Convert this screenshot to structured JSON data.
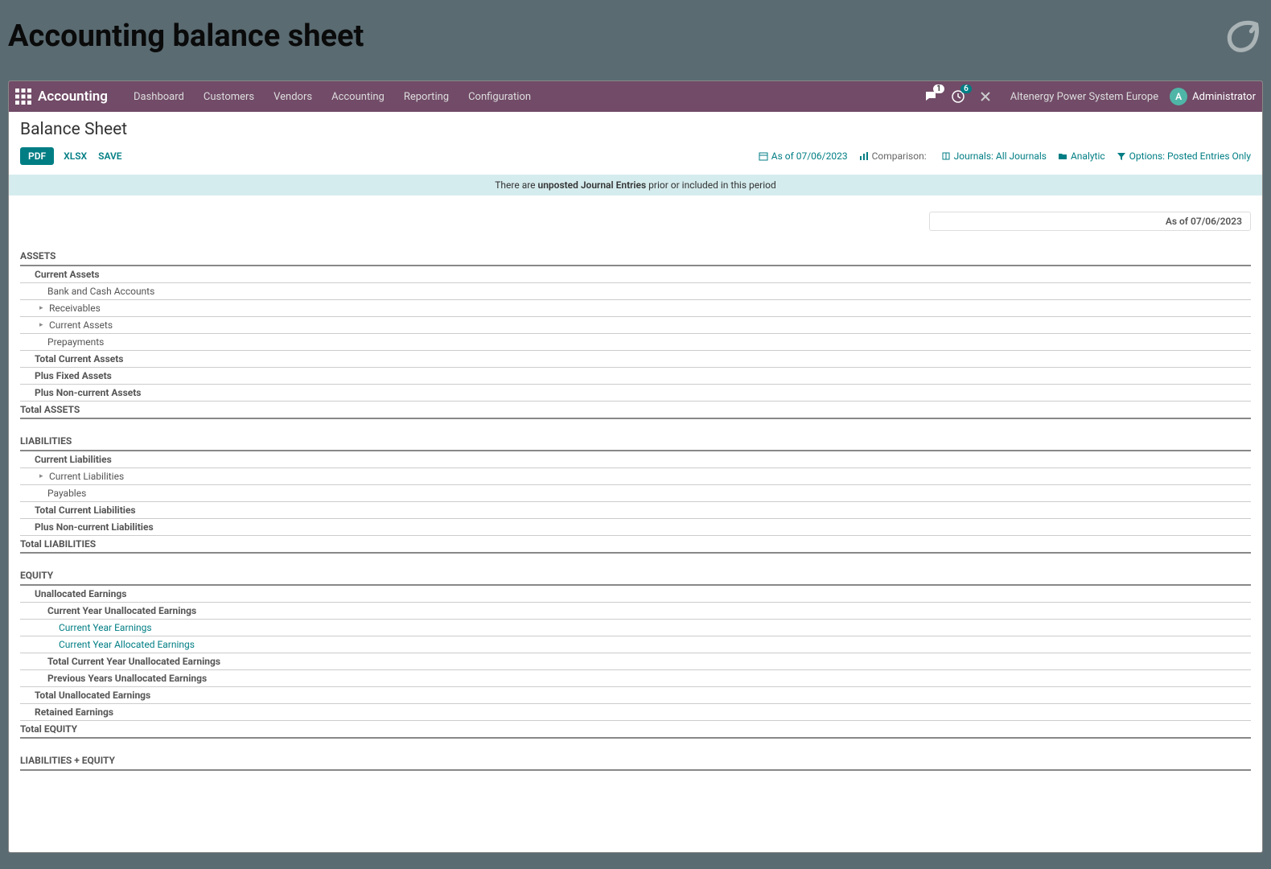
{
  "header": {
    "title": "Accounting balance sheet"
  },
  "nav": {
    "app_name": "Accounting",
    "items": [
      "Dashboard",
      "Customers",
      "Vendors",
      "Accounting",
      "Reporting",
      "Configuration"
    ],
    "company": "Altenergy Power System Europe",
    "user": "Administrator",
    "avatar_letter": "A",
    "msg_badge": "1",
    "activity_badge": "6"
  },
  "page": {
    "title": "Balance Sheet",
    "pdf": "PDF",
    "xlsx": "XLSX",
    "save": "SAVE",
    "filters": {
      "date": "As of 07/06/2023",
      "comparison_label": "Comparison:",
      "journals": "Journals: All Journals",
      "analytic": "Analytic",
      "options": "Options: Posted Entries Only"
    },
    "notice_prefix": "There are ",
    "notice_bold": "unposted Journal Entries",
    "notice_suffix": " prior or included in this period",
    "date_column": "As of 07/06/2023"
  },
  "sections": {
    "assets": {
      "head": "ASSETS",
      "current_assets": "Current Assets",
      "bank": "Bank and Cash Accounts",
      "receivables": "Receivables",
      "current_assets_sub": "Current Assets",
      "prepayments": "Prepayments",
      "total_current": "Total Current Assets",
      "fixed": "Plus Fixed Assets",
      "noncurrent": "Plus Non-current Assets",
      "total": "Total ASSETS"
    },
    "liabilities": {
      "head": "LIABILITIES",
      "current": "Current Liabilities",
      "current_sub": "Current Liabilities",
      "payables": "Payables",
      "total_current": "Total Current Liabilities",
      "noncurrent": "Plus Non-current Liabilities",
      "total": "Total LIABILITIES"
    },
    "equity": {
      "head": "EQUITY",
      "unallocated": "Unallocated Earnings",
      "cy_unallocated": "Current Year Unallocated Earnings",
      "cy_earnings": "Current Year Earnings",
      "cy_allocated": "Current Year Allocated Earnings",
      "total_cy": "Total Current Year Unallocated Earnings",
      "previous": "Previous Years Unallocated Earnings",
      "total_unallocated": "Total Unallocated Earnings",
      "retained": "Retained Earnings",
      "total": "Total EQUITY"
    },
    "liab_equity": "LIABILITIES + EQUITY"
  }
}
